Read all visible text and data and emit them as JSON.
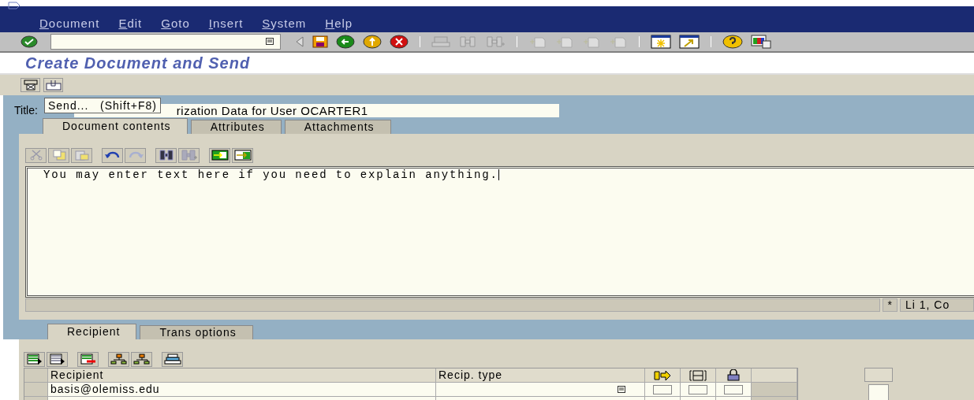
{
  "menu": [
    "Document",
    "Edit",
    "Goto",
    "Insert",
    "System",
    "Help"
  ],
  "screen_title": "Create Document and Send",
  "tooltip": "Send...   (Shift+F8)",
  "title_field": {
    "label": "Title:",
    "value": "rization Data for User OCARTER1"
  },
  "tabs": [
    {
      "label": "Document contents",
      "selected": true
    },
    {
      "label": "Attributes",
      "selected": false
    },
    {
      "label": "Attachments",
      "selected": false
    }
  ],
  "editor_text": "You may enter text here if you need to explain anything.",
  "editor_status": [
    "*",
    "Li 1, Co"
  ],
  "bottom_tabs": [
    {
      "label": "Recipient",
      "selected": true
    },
    {
      "label": "Trans options",
      "selected": false
    }
  ],
  "table": {
    "columns": [
      "Recipient",
      "Recip. type"
    ],
    "rows": [
      {
        "recipient": "basis@olemiss.edu",
        "flags": [
          false,
          false,
          false
        ]
      }
    ]
  }
}
